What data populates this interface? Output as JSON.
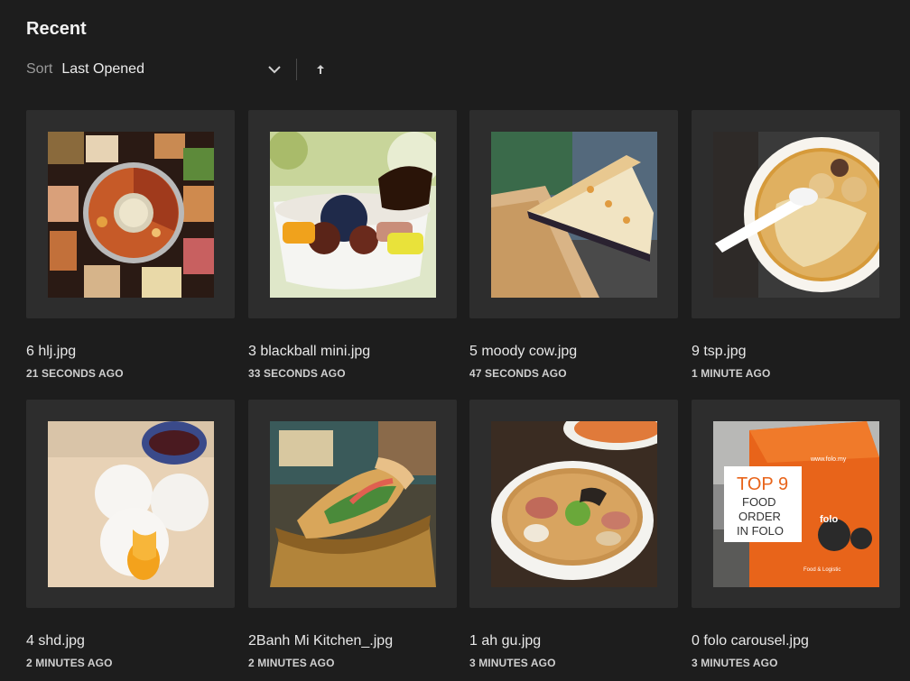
{
  "header": {
    "title": "Recent"
  },
  "sort": {
    "label": "Sort",
    "value": "Last Opened"
  },
  "files": [
    {
      "name": "6 hlj.jpg",
      "time": "21 SECONDS AGO",
      "thumb": "hotpot-photo"
    },
    {
      "name": "3 blackball mini.jpg",
      "time": "33 SECONDS AGO",
      "thumb": "dessert-bowl-photo"
    },
    {
      "name": "5 moody cow.jpg",
      "time": "47 SECONDS AGO",
      "thumb": "cake-slice-photo"
    },
    {
      "name": "9 tsp.jpg",
      "time": "1 MINUTE AGO",
      "thumb": "dessert-soup-photo"
    },
    {
      "name": "4 shd.jpg",
      "time": "2 MINUTES AGO",
      "thumb": "buns-photo"
    },
    {
      "name": "2Banh Mi Kitchen_.jpg",
      "time": "2 MINUTES AGO",
      "thumb": "banh-mi-photo"
    },
    {
      "name": "1 ah gu.jpg",
      "time": "3 MINUTES AGO",
      "thumb": "ramen-photo"
    },
    {
      "name": "0 folo carousel.jpg",
      "time": "3 MINUTES AGO",
      "thumb": "delivery-bag-photo",
      "thumb_text": {
        "line1": "TOP 9",
        "line2": "FOOD",
        "line3": "ORDER",
        "line4": "IN FOLO",
        "brand": "folo",
        "site": "www.folo.my",
        "tag": "Food & Logistic"
      }
    }
  ]
}
